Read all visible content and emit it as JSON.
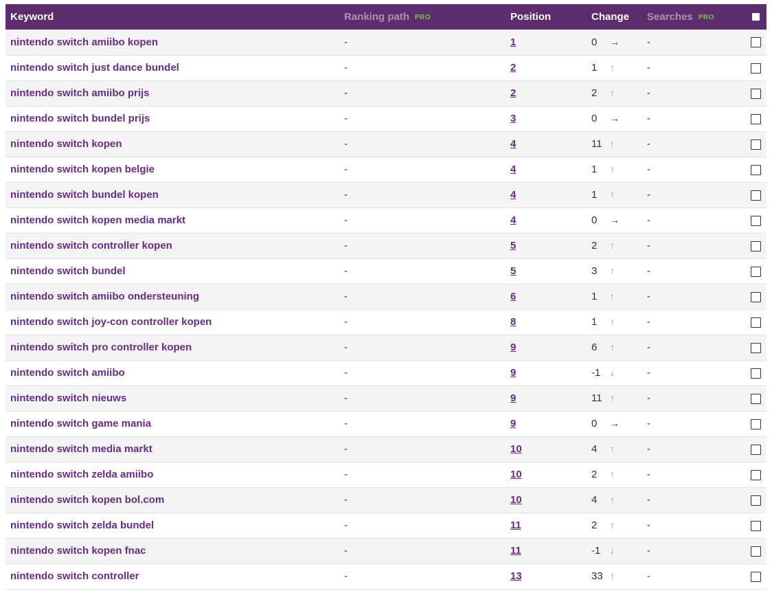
{
  "table": {
    "columns": {
      "keyword": "Keyword",
      "ranking_path": "Ranking path",
      "position": "Position",
      "change": "Change",
      "searches": "Searches",
      "pro_badge": "PRO"
    },
    "colors": {
      "header_bg": "#5b2d6e",
      "keyword_text": "#6a2b85",
      "arrow_up": "#7dc242",
      "arrow_down": "#e8781f",
      "pro_badge": "#7dc242"
    },
    "rows": [
      {
        "keyword": "nintendo switch amiibo kopen",
        "ranking_path": "-",
        "position": "1",
        "change": "0",
        "trend": "flat",
        "searches": "-"
      },
      {
        "keyword": "nintendo switch just dance bundel",
        "ranking_path": "-",
        "position": "2",
        "change": "1",
        "trend": "up",
        "searches": "-"
      },
      {
        "keyword": "nintendo switch amiibo prijs",
        "ranking_path": "-",
        "position": "2",
        "change": "2",
        "trend": "up",
        "searches": "-"
      },
      {
        "keyword": "nintendo switch bundel prijs",
        "ranking_path": "-",
        "position": "3",
        "change": "0",
        "trend": "flat",
        "searches": "-"
      },
      {
        "keyword": "nintendo switch kopen",
        "ranking_path": "-",
        "position": "4",
        "change": "11",
        "trend": "up",
        "searches": "-"
      },
      {
        "keyword": "nintendo switch kopen belgie",
        "ranking_path": "-",
        "position": "4",
        "change": "1",
        "trend": "up",
        "searches": "-"
      },
      {
        "keyword": "nintendo switch bundel kopen",
        "ranking_path": "-",
        "position": "4",
        "change": "1",
        "trend": "up",
        "searches": "-"
      },
      {
        "keyword": "nintendo switch kopen media markt",
        "ranking_path": "-",
        "position": "4",
        "change": "0",
        "trend": "flat",
        "searches": "-"
      },
      {
        "keyword": "nintendo switch controller kopen",
        "ranking_path": "-",
        "position": "5",
        "change": "2",
        "trend": "up",
        "searches": "-"
      },
      {
        "keyword": "nintendo switch bundel",
        "ranking_path": "-",
        "position": "5",
        "change": "3",
        "trend": "up",
        "searches": "-"
      },
      {
        "keyword": "nintendo switch amiibo ondersteuning",
        "ranking_path": "-",
        "position": "6",
        "change": "1",
        "trend": "up",
        "searches": "-"
      },
      {
        "keyword": "nintendo switch joy-con controller kopen",
        "ranking_path": "-",
        "position": "8",
        "change": "1",
        "trend": "up",
        "searches": "-"
      },
      {
        "keyword": "nintendo switch pro controller kopen",
        "ranking_path": "-",
        "position": "9",
        "change": "6",
        "trend": "up",
        "searches": "-"
      },
      {
        "keyword": "nintendo switch amiibo",
        "ranking_path": "-",
        "position": "9",
        "change": "-1",
        "trend": "down",
        "searches": "-"
      },
      {
        "keyword": "nintendo switch nieuws",
        "ranking_path": "-",
        "position": "9",
        "change": "11",
        "trend": "up",
        "searches": "-"
      },
      {
        "keyword": "nintendo switch game mania",
        "ranking_path": "-",
        "position": "9",
        "change": "0",
        "trend": "flat",
        "searches": "-"
      },
      {
        "keyword": "nintendo switch media markt",
        "ranking_path": "-",
        "position": "10",
        "change": "4",
        "trend": "up",
        "searches": "-"
      },
      {
        "keyword": "nintendo switch zelda amiibo",
        "ranking_path": "-",
        "position": "10",
        "change": "2",
        "trend": "up",
        "searches": "-"
      },
      {
        "keyword": "nintendo switch kopen bol.com",
        "ranking_path": "-",
        "position": "10",
        "change": "4",
        "trend": "up",
        "searches": "-"
      },
      {
        "keyword": "nintendo switch zelda bundel",
        "ranking_path": "-",
        "position": "11",
        "change": "2",
        "trend": "up",
        "searches": "-"
      },
      {
        "keyword": "nintendo switch kopen fnac",
        "ranking_path": "-",
        "position": "11",
        "change": "-1",
        "trend": "down",
        "searches": "-"
      },
      {
        "keyword": "nintendo switch controller",
        "ranking_path": "-",
        "position": "13",
        "change": "33",
        "trend": "up",
        "searches": "-"
      }
    ]
  }
}
